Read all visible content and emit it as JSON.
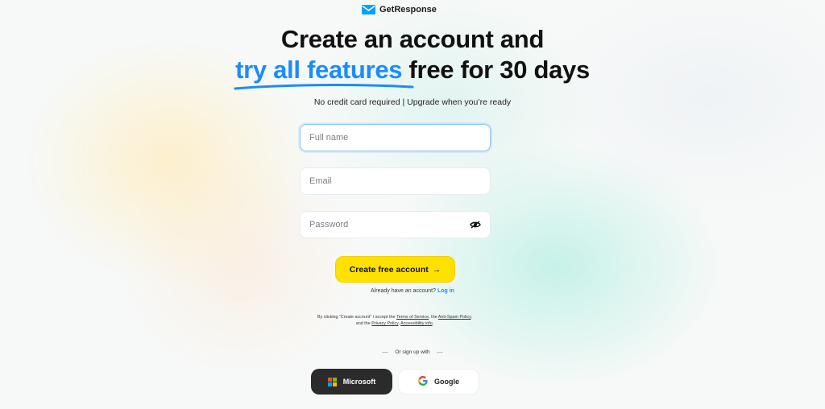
{
  "brand": {
    "name": "GetResponse",
    "icon": "envelope-logo-icon",
    "color": "#00a2ff"
  },
  "headline": {
    "line1": "Create an account and",
    "highlight": "try all features",
    "line2_rest": " free for 30 days",
    "highlight_color": "#1a8cff"
  },
  "subtitle": "No credit card required | Upgrade when you’re ready",
  "form": {
    "full_name": {
      "placeholder": "Full name",
      "value": ""
    },
    "email": {
      "placeholder": "Email",
      "value": ""
    },
    "password": {
      "placeholder": "Password",
      "value": "",
      "toggle_icon": "eye-icon"
    },
    "submit_label": "Create free account",
    "submit_arrow": "→",
    "submit_color": "#ffe100"
  },
  "login": {
    "prompt": "Already have an account? ",
    "link": "Log in"
  },
  "legal": {
    "part1": "By clicking “Create account” I accept the ",
    "terms": "Terms of Service",
    "part2": ", the ",
    "antispam": "Anti-Spam Policy",
    "part3": ", and the ",
    "privacy": "Privacy Policy",
    "part4": ", ",
    "accessibility": "Accessibility info",
    "part5": "."
  },
  "divider": "Or sign up with",
  "social": {
    "microsoft": {
      "label": "Microsoft",
      "icon": "microsoft-logo-icon"
    },
    "google": {
      "label": "Google",
      "icon": "google-logo-icon"
    }
  }
}
